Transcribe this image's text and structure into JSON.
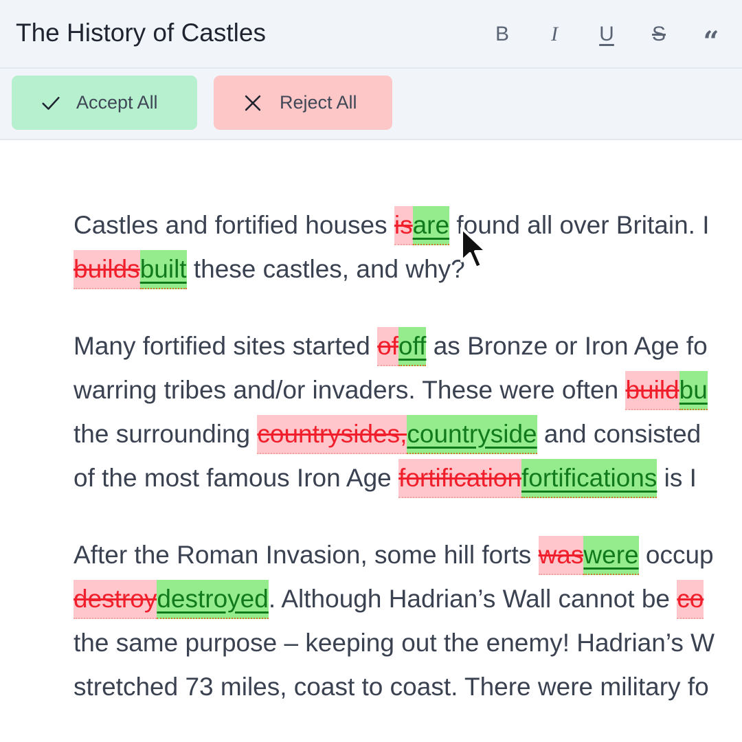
{
  "header": {
    "title": "The History of Castles",
    "format_buttons": [
      {
        "name": "bold",
        "glyph": "B"
      },
      {
        "name": "italic",
        "glyph": "I"
      },
      {
        "name": "underline",
        "glyph": "U"
      },
      {
        "name": "strikethrough",
        "glyph": "S"
      },
      {
        "name": "quote",
        "glyph": "“"
      }
    ]
  },
  "toolbar": {
    "accept_label": "Accept All",
    "reject_label": "Reject All",
    "accept_icon": "check-icon",
    "reject_icon": "x-icon"
  },
  "document": {
    "p1": {
      "l1": {
        "t1": "Castles and fortified houses ",
        "del1": "is",
        "ins1": "are",
        "t2": " found all over Britain. I"
      },
      "l2": {
        "del1": "builds",
        "ins1": "built",
        "t1": " these castles, and why?"
      }
    },
    "p2": {
      "l1": {
        "t1": "Many fortified sites started ",
        "del1": "of",
        "ins1": "off",
        "t2": " as Bronze or Iron Age fo"
      },
      "l2": {
        "t1": "warring tribes and/or invaders. These were often ",
        "del1": "build",
        "ins1": "bu"
      },
      "l3": {
        "t1": "the surrounding ",
        "del1": "countrysides,",
        "ins1": "countryside",
        "t2": " and consisted"
      },
      "l4": {
        "t1": "of the most famous Iron Age ",
        "del1": "fortification",
        "ins1": "fortifications",
        "t2": " is I"
      }
    },
    "p3": {
      "l1": {
        "t1": "After the Roman Invasion, some hill forts ",
        "del1": "was",
        "ins1": "were",
        "t2": " occup"
      },
      "l2": {
        "del1": "destroy",
        "ins1": "destroyed",
        "t1": ". Although Hadrian’s Wall cannot be ",
        "del2": "co"
      },
      "l3": {
        "t1": "the same purpose – keeping out the enemy! Hadrian’s W"
      },
      "l4": {
        "t1": "stretched 73 miles, coast to coast. There were military fo"
      }
    }
  },
  "colors": {
    "deletion_bg": "#ffc6cc",
    "deletion_text": "#f01f2b",
    "insertion_bg": "#94ec8c",
    "insertion_text": "#107a1c",
    "accept_bg": "#b6f0cf",
    "reject_bg": "#fdc7c7"
  }
}
